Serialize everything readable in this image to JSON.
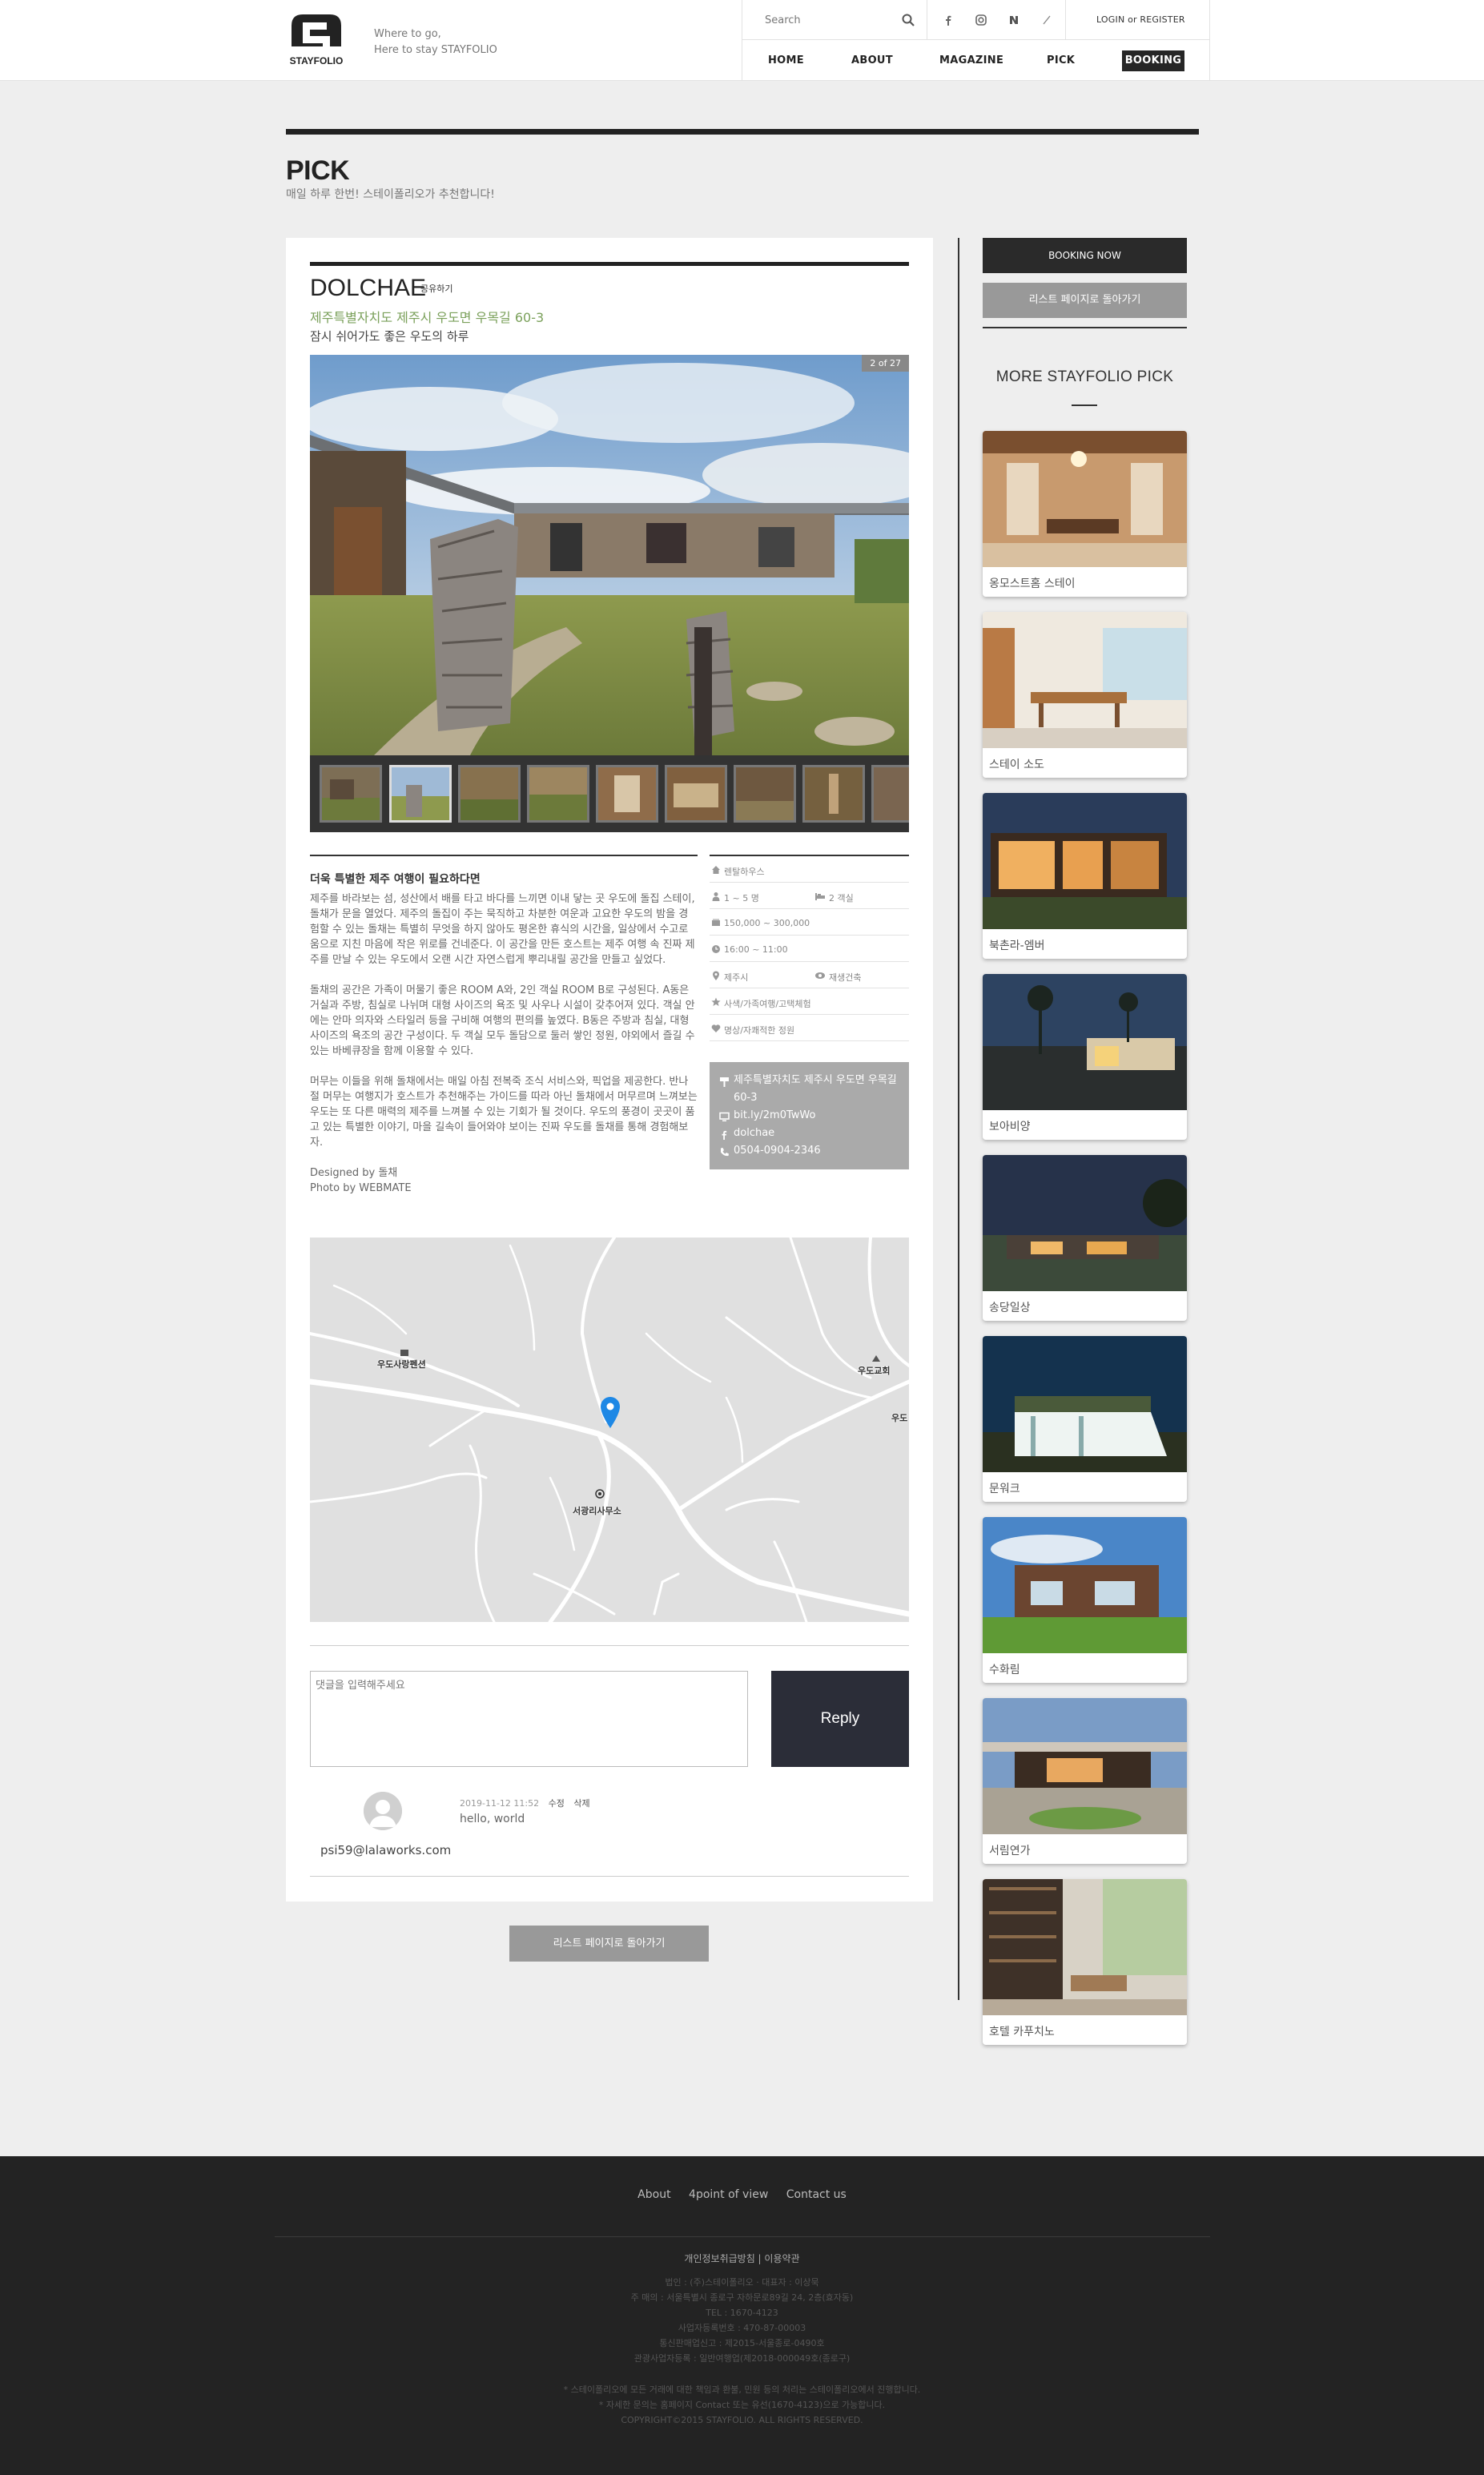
{
  "header": {
    "logo_text": "STAYFOLIO",
    "tagline_line1": "Where to go,",
    "tagline_line2": "Here to stay STAYFOLIO",
    "search_placeholder": "Search",
    "login": "LOGIN or REGISTER",
    "nav": {
      "home": "HOME",
      "about": "ABOUT",
      "magazine": "MAGAZINE",
      "pick": "PICK",
      "booking": "BOOKING"
    }
  },
  "page": {
    "title": "PICK",
    "subtitle": "매일 하루 한번! 스테이폴리오가 추천합니다!"
  },
  "place": {
    "name": "DOLCHAE",
    "share": "공유하기",
    "address": "제주특별자치도 제주시 우도면 우목길 60-3",
    "tagline": "잠시 쉬어가도 좋은 우도의 하루",
    "photo_counter": "2 of 27",
    "description_title": "더욱 특별한 제주 여행이 필요하다면",
    "description_paragraphs": [
      "제주를 바라보는 섬, 성산에서 배를 타고 바다를 느끼면 이내 닿는 곳 우도에 돌집 스테이, 돌채가 문을 열었다. 제주의 돌집이 주는 묵직하고 차분한 여운과 고요한 우도의 밤을 경험할 수 있는 돌채는 특별히 무엇을 하지 않아도 평온한 휴식의 시간을, 일상에서 수고로움으로 지친 마음에 작은 위로를 건네준다. 이 공간을 만든 호스트는 제주 여행 속 진짜 제주를 만날 수 있는 우도에서 오랜 시간 자연스럽게 뿌리내릴 공간을 만들고 싶었다.",
      "돌채의 공간은 가족이 머물기 좋은 ROOM A와, 2인 객실 ROOM B로 구성된다. A동은 거실과 주방, 침실로 나뉘며 대형 사이즈의 욕조 및 사우나 시설이 갖추어져 있다. 객실 안에는 안마 의자와 스타일러 등을 구비해 여행의 편의를 높였다. B동은 주방과 침실, 대형 사이즈의 욕조의 공간 구성이다. 두 객실 모두 돌담으로 둘러 쌓인 정원, 야외에서 즐길 수 있는 바베큐장을 함께 이용할 수 있다.",
      "머무는 이들을 위해 돌채에서는 매일 아침 전복죽 조식 서비스와, 픽업을 제공한다. 반나절 머무는 여행지가 호스트가 추천해주는 가이드를 따라 아닌 돌채에서 머무르며 느껴보는 우도는 또 다른 매력의 제주를 느껴볼 수 있는 기회가 될 것이다. 우도의 풍경이 곳곳이 품고 있는 특별한 이야기, 마을 길속이 들어와야 보이는 진짜 우도를 돌채를 통해 경험해보자."
    ],
    "credit_designed": "Designed by 돌채",
    "credit_photo": "Photo by WEBMATE",
    "info": {
      "type": "렌탈하우스",
      "guests": "1 ~ 5 명",
      "rooms": "2 객실",
      "price": "150,000 ~ 300,000",
      "checkin": "16:00 ~ 11:00",
      "region": "제주시",
      "tag2": "재생건축",
      "feature1": "사색/가족여행/고택체험",
      "feature2": "명상/자쾌적한 정원"
    },
    "contact": {
      "address": "제주특별자치도 제주시 우도면 우목길 60-3",
      "website": "bit.ly/2m0TwWo",
      "facebook": "dolchae",
      "phone": "0504-0904-2346"
    }
  },
  "map": {
    "labels": {
      "udo_pension": "우도사랑펜션",
      "udo_church": "우도교회",
      "office": "서광리사무소",
      "udo": "우도"
    }
  },
  "comments": {
    "placeholder": "댓글을 입력해주세요",
    "reply": "Reply",
    "items": [
      {
        "date": "2019-11-12 11:52",
        "edit": "수정",
        "delete": "삭제",
        "text": "hello, world",
        "user": "psi59@lalaworks.com"
      }
    ]
  },
  "buttons": {
    "back_to_list": "리스트 페이지로 돌아가기",
    "booking_now": "BOOKING NOW"
  },
  "sidebar": {
    "more_title": "MORE STAYFOLIO PICK",
    "picks": [
      {
        "name": "옹모스트홈 스테이"
      },
      {
        "name": "스테이 소도"
      },
      {
        "name": "북촌라-엠버"
      },
      {
        "name": "보아비양"
      },
      {
        "name": "송당일상"
      },
      {
        "name": "문워크"
      },
      {
        "name": "수화림"
      },
      {
        "name": "서림연가"
      },
      {
        "name": "호텔 카푸치노"
      }
    ]
  },
  "footer": {
    "links": [
      "About",
      "4point of view",
      "Contact us"
    ],
    "policy": "개인정보취급방침 | 이용약관",
    "info_lines": [
      "법인 : (주)스테이폴리오 · 대표자 : 이상묵",
      "주 매의 : 서울특별시 종로구 자하문로89길 24, 2층(효자동)",
      "TEL : 1670-4123",
      "사업자등록번호 : 470-87-00003",
      "통신판매업신고 : 제2015-서울종로-0490호",
      "관광사업자등록 : 일반여행업(제2018-000049호(종로구)"
    ],
    "notice_lines": [
      "* 스테이폴리오에 모든 거래에 대한 책임과 환불, 민원 등의 처리는 스테이폴리오에서 진행합니다.",
      "* 자세한 문의는 홈페이지 Contact 또는 유선(1670-4123)으로 가능합니다.",
      "COPYRIGHT©2015 STAYFOLIO. ALL RIGHTS RESERVED."
    ]
  },
  "colors": {
    "accent_green": "#7aa05a",
    "dark": "#222222",
    "reply_button": "#2b2d38",
    "map_pin": "#1e88e5"
  }
}
